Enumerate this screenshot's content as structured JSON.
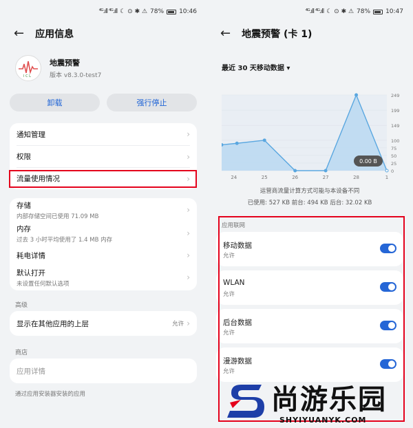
{
  "left": {
    "status": {
      "signal": "⁴ᴳ.ıll ⁴ᴳ.ıll",
      "icons": "☾ ⊙ ✱ ⚠",
      "battery": "78%",
      "time": "10:46"
    },
    "header": {
      "title": "应用信息"
    },
    "app": {
      "name": "地震预警",
      "version": "版本 v8.3.0-test7"
    },
    "buttons": {
      "uninstall": "卸载",
      "force_stop": "强行停止"
    },
    "group1": [
      {
        "label": "通知管理"
      },
      {
        "label": "权限"
      },
      {
        "label": "流量使用情况"
      }
    ],
    "group2": [
      {
        "label": "存储",
        "sub": "内部存储空间已使用 71.09 MB"
      },
      {
        "label": "内存",
        "sub": "过去 3 小时平均使用了 1.4 MB 内存"
      },
      {
        "label": "耗电详情",
        "sub": ""
      },
      {
        "label": "默认打开",
        "sub": "未设置任何默认选项"
      }
    ],
    "advanced": {
      "section": "高级",
      "label": "显示在其他应用的上层",
      "value": "允许"
    },
    "store": {
      "section": "商店",
      "label": "应用详情",
      "footer": "通过应用安装器安装的应用"
    }
  },
  "right": {
    "status": {
      "signal": "⁴ᴳ.ıll ⁴ᴳ.ıll",
      "icons": "☾ ⊙ ✱ ⚠",
      "battery": "78%",
      "time": "10:47"
    },
    "header": {
      "title": "地震预警 (卡 1)"
    },
    "range": "最近 30 天移动数据 ▾",
    "note1": "运营商流量计算方式可能与本设备不同",
    "note2": "已使用: 527 KB 前台: 494 KB 后台: 32.02 KB",
    "net_section": "应用联网",
    "toggles": [
      {
        "label": "移动数据",
        "sub": "允许",
        "on": true
      },
      {
        "label": "WLAN",
        "sub": "允许",
        "on": true
      },
      {
        "label": "后台数据",
        "sub": "允许",
        "on": true
      },
      {
        "label": "漫游数据",
        "sub": "允许",
        "on": true
      }
    ],
    "watermark": {
      "text": "尚游乐园",
      "url": "SHYIYUANYK.COM"
    }
  },
  "chart_data": {
    "type": "area",
    "x": [
      24,
      25,
      26,
      27,
      28,
      1
    ],
    "x_tick_labels": [
      "24",
      "25",
      "26",
      "27",
      "28",
      "1"
    ],
    "points": [
      {
        "x": 23.6,
        "y": 85
      },
      {
        "x": 24.1,
        "y": 90
      },
      {
        "x": 25.0,
        "y": 100
      },
      {
        "x": 26.0,
        "y": 0
      },
      {
        "x": 27.0,
        "y": 0
      },
      {
        "x": 28.0,
        "y": 249
      },
      {
        "x": 29.0,
        "y": 0
      }
    ],
    "y_ticks": [
      0,
      25,
      50,
      75,
      100,
      149,
      199,
      249
    ],
    "ylim": [
      0,
      249
    ],
    "tooltip": "0.00 B",
    "grid": true,
    "color": "#5aa7e0"
  }
}
